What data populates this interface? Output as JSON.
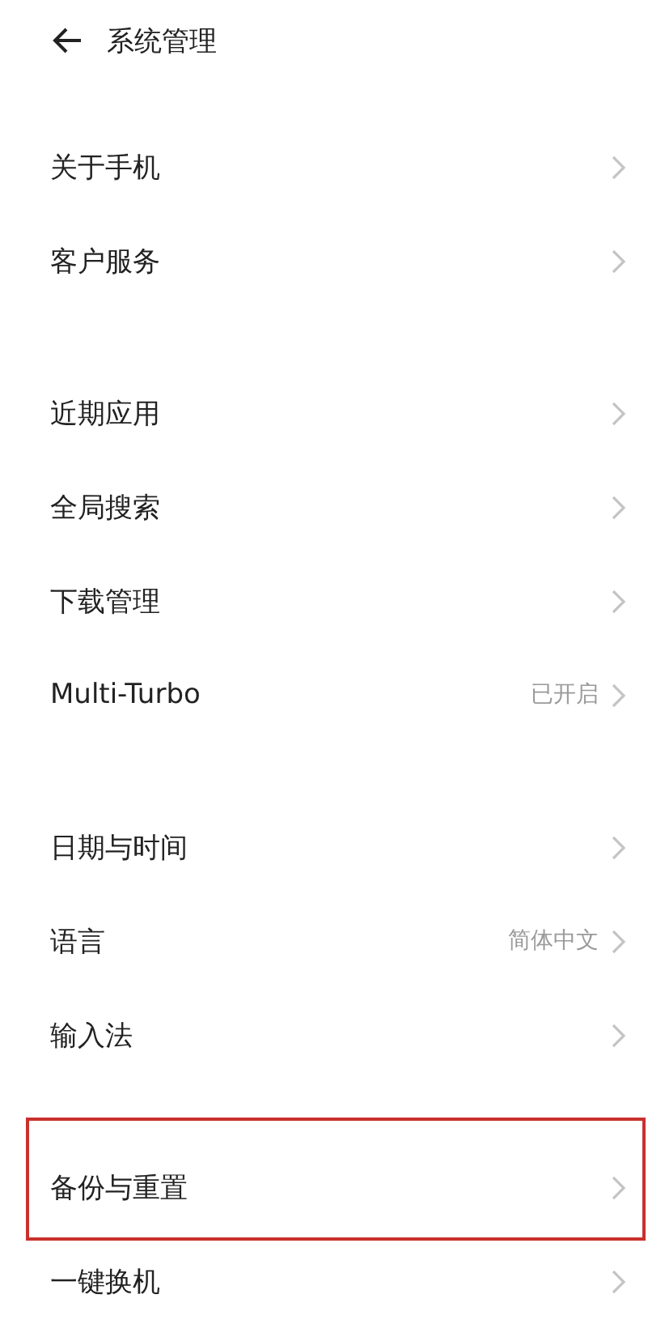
{
  "header": {
    "title": "系统管理"
  },
  "groups": [
    {
      "items": [
        {
          "label": "关于手机",
          "highlighted": false
        },
        {
          "label": "客户服务",
          "highlighted": false
        }
      ]
    },
    {
      "items": [
        {
          "label": "近期应用",
          "highlighted": false
        },
        {
          "label": "全局搜索",
          "highlighted": false
        },
        {
          "label": "下载管理",
          "highlighted": false
        },
        {
          "label": "Multi-Turbo",
          "value": "已开启",
          "highlighted": false
        }
      ]
    },
    {
      "items": [
        {
          "label": "日期与时间",
          "highlighted": false
        },
        {
          "label": "语言",
          "value": "简体中文",
          "highlighted": false
        },
        {
          "label": "输入法",
          "highlighted": false
        }
      ]
    },
    {
      "items": [
        {
          "label": "备份与重置",
          "highlighted": true
        },
        {
          "label": "一键换机",
          "highlighted": false
        }
      ]
    }
  ]
}
